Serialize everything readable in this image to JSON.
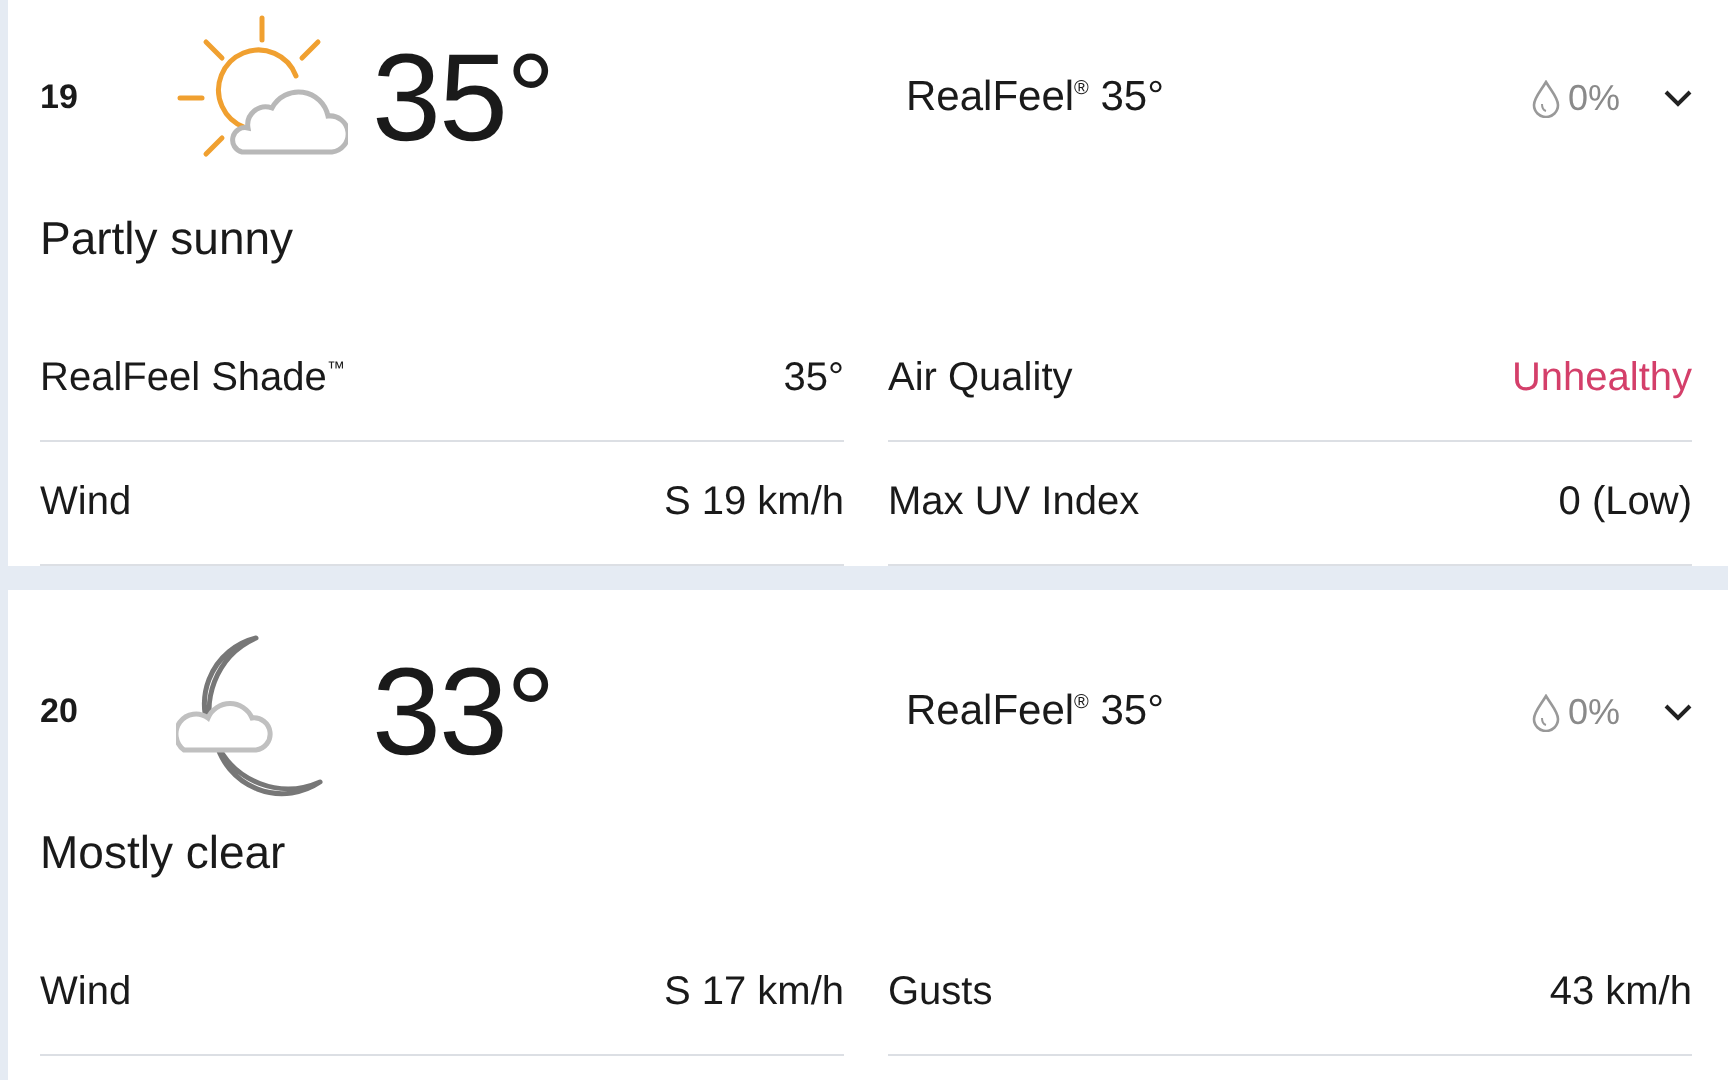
{
  "hours": [
    {
      "hour": "19",
      "kind": "partly-sunny",
      "temp": "35°",
      "realfeel": "RealFeel$^{®}$ 35°",
      "precip": "0%",
      "condition": "Partly sunny",
      "details": [
        [
          {
            "label": "RealFeel Shade$^{™}$",
            "value": "35°"
          },
          {
            "label": "Air Quality",
            "value": "Unhealthy",
            "color": "#d43f6a"
          }
        ],
        [
          {
            "label": "Wind",
            "value": "S 19 km/h"
          },
          {
            "label": "Max UV Index",
            "value": "0 (Low)"
          }
        ]
      ]
    },
    {
      "hour": "20",
      "kind": "moon-cloud",
      "temp": "33°",
      "realfeel": "RealFeel$^{®}$ 35°",
      "precip": "0%",
      "condition": "Mostly clear",
      "details": [
        [
          {
            "label": "Wind",
            "value": "S 17 km/h"
          },
          {
            "label": "Gusts",
            "value": "43 km/h"
          }
        ]
      ]
    }
  ]
}
